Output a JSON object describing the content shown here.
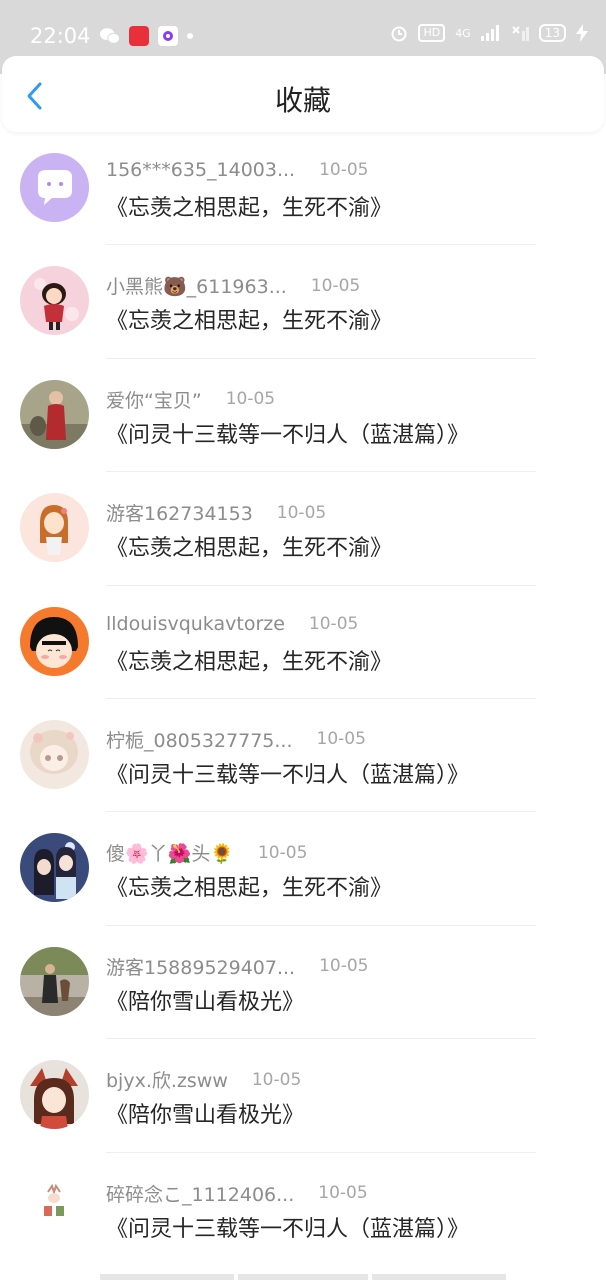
{
  "status_bar": {
    "time": "22:04",
    "left_icons": [
      "wechat-icon",
      "app-red-icon",
      "app-purple-icon",
      "dot-icon"
    ],
    "hd": "HD",
    "network": "4G",
    "battery": "13"
  },
  "header": {
    "title": "收藏"
  },
  "items": [
    {
      "username": "156***635_14003...",
      "date": "10-05",
      "title": "《忘羡之相思起，生死不渝》"
    },
    {
      "username": "小黑熊🐻_611963...",
      "date": "10-05",
      "title": "《忘羡之相思起，生死不渝》"
    },
    {
      "username": "爱你“宝贝”",
      "date": "10-05",
      "title": "《问灵十三载等一不归人（蓝湛篇）》"
    },
    {
      "username": "游客162734153",
      "date": "10-05",
      "title": "《忘羡之相思起，生死不渝》"
    },
    {
      "username": "lldouisvqukavtorze",
      "date": "10-05",
      "title": "《忘羡之相思起，生死不渝》"
    },
    {
      "username": "柠栀_0805327775...",
      "date": "10-05",
      "title": "《问灵十三载等一不归人（蓝湛篇）》"
    },
    {
      "username": "傻🌸丫🌺头🌻",
      "date": "10-05",
      "title": "《忘羡之相思起，生死不渝》"
    },
    {
      "username": "游客15889529407...",
      "date": "10-05",
      "title": "《陪你雪山看极光》"
    },
    {
      "username": "bjyx.欣.zsww",
      "date": "10-05",
      "title": "《陪你雪山看极光》"
    },
    {
      "username": "碎碎念こ_1112406...",
      "date": "10-05",
      "title": "《问灵十三载等一不归人（蓝湛篇）》"
    }
  ],
  "colors": {
    "accent": "#2d9cf0",
    "status_bar_bg": "#d9d9d9"
  }
}
